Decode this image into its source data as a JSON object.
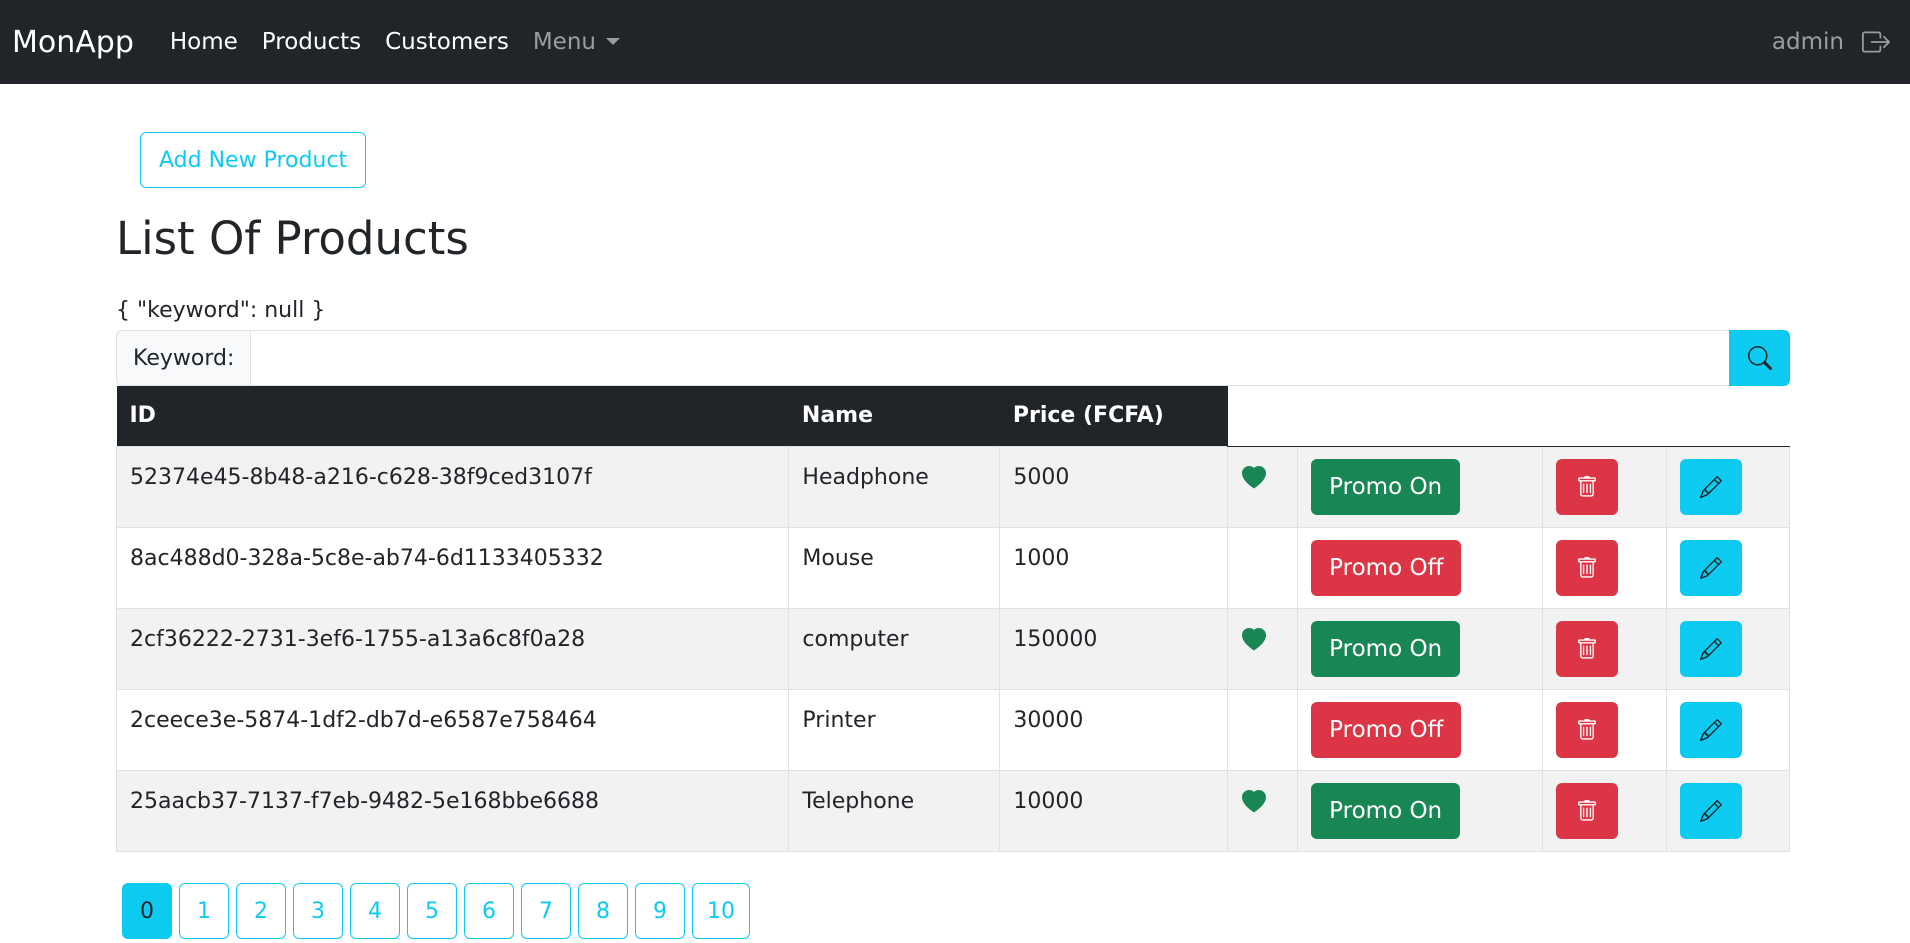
{
  "navbar": {
    "brand": "MonApp",
    "links": [
      "Home",
      "Products",
      "Customers"
    ],
    "menu_label": "Menu",
    "user": "admin"
  },
  "main": {
    "add_button": "Add New Product",
    "title": "List Of Products",
    "keyword_json": "{ \"keyword\": null }",
    "search_label": "Keyword:",
    "search_value": ""
  },
  "table": {
    "headers": [
      "ID",
      "Name",
      "Price (FCFA)"
    ],
    "rows": [
      {
        "id": "52374e45-8b48-a216-c628-38f9ced3107f",
        "name": "Headphone",
        "price": "5000",
        "liked": true,
        "promo": "Promo On"
      },
      {
        "id": "8ac488d0-328a-5c8e-ab74-6d1133405332",
        "name": "Mouse",
        "price": "1000",
        "liked": false,
        "promo": "Promo Off"
      },
      {
        "id": "2cf36222-2731-3ef6-1755-a13a6c8f0a28",
        "name": "computer",
        "price": "150000",
        "liked": true,
        "promo": "Promo On"
      },
      {
        "id": "2ceece3e-5874-1df2-db7d-e6587e758464",
        "name": "Printer",
        "price": "30000",
        "liked": false,
        "promo": "Promo Off"
      },
      {
        "id": "25aacb37-7137-f7eb-9482-5e168bbe6688",
        "name": "Telephone",
        "price": "10000",
        "liked": true,
        "promo": "Promo On"
      }
    ]
  },
  "pagination": {
    "pages": [
      "0",
      "1",
      "2",
      "3",
      "4",
      "5",
      "6",
      "7",
      "8",
      "9",
      "10"
    ],
    "active": "0"
  },
  "colors": {
    "navbar_bg": "#212529",
    "info": "#0dcaf0",
    "success": "#198754",
    "danger": "#dc3545"
  },
  "icons": {
    "search": "search-icon",
    "logout": "logout-icon",
    "heart": "heart-icon",
    "delete": "trash-icon",
    "edit": "pencil-icon"
  }
}
